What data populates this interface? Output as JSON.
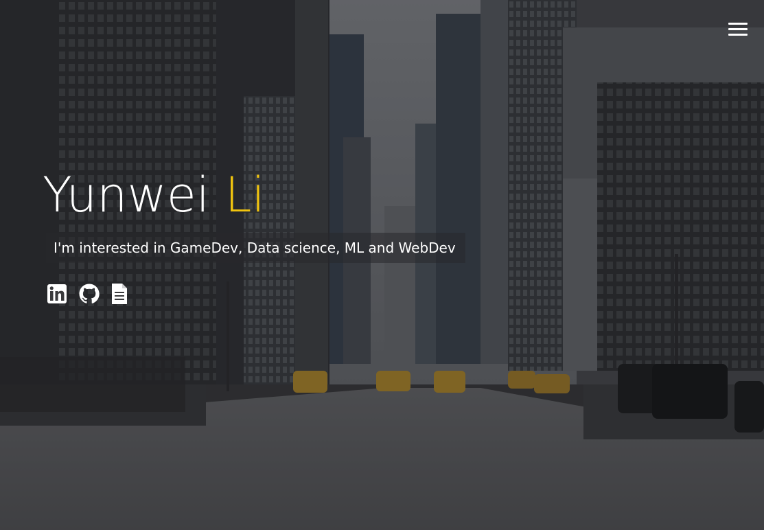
{
  "hero": {
    "first_name": "Yunwei",
    "last_name": "Li",
    "tagline": "I'm interested in GameDev, Data science, ML and WebDev",
    "accent_color": "#f1c40f",
    "background_theme": "city-street-photo"
  },
  "header": {
    "menu_icon": "hamburger-menu-icon"
  },
  "social_links": [
    {
      "icon": "linkedin-icon"
    },
    {
      "icon": "github-icon"
    },
    {
      "icon": "document-icon"
    }
  ]
}
